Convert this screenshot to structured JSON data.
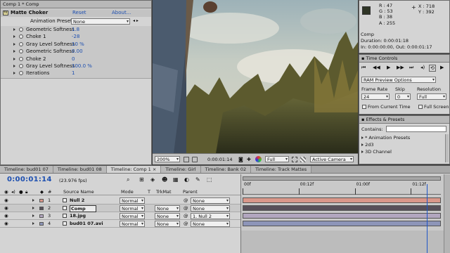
{
  "effect_panel": {
    "tab_title": "Comp 1 * Comp",
    "effect_name": "Matte Choker",
    "reset_label": "Reset",
    "about_label": "About...",
    "presets_label": "Animation Presets:",
    "presets_value": "None",
    "params": [
      {
        "name": "Geometric Softness",
        "value": "1.8"
      },
      {
        "name": "Choke 1",
        "value": "-28"
      },
      {
        "name": "Gray Level Softness",
        "value": "10 %"
      },
      {
        "name": "Geometric Softness",
        "value": "0.00"
      },
      {
        "name": "Choke 2",
        "value": "0"
      },
      {
        "name": "Gray Level Softness",
        "value": "100.0 %"
      },
      {
        "name": "Iterations",
        "value": "1"
      }
    ]
  },
  "viewer": {
    "zoom": "200%",
    "timecode": "0:00:01:14",
    "resolution": "Full",
    "camera": "Active Camera"
  },
  "info_panel": {
    "r_label": "R :",
    "r_value": "47",
    "g_label": "G :",
    "g_value": "53",
    "b_label": "B :",
    "b_value": "38",
    "a_label": "A :",
    "a_value": "255",
    "x_label": "X :",
    "x_value": "718",
    "y_label": "Y :",
    "y_value": "392",
    "swatch_color": "#2f3526",
    "comp_name": "Comp",
    "duration": "Duration: 0:00:01:18",
    "in_out": "In: 0:00:00:00, Out: 0:00:01:17"
  },
  "time_controls": {
    "title": "Time Controls",
    "preview_options": "RAM Preview Options",
    "frame_rate_label": "Frame Rate",
    "frame_rate_value": "24",
    "skip_label": "Skip",
    "skip_value": "0",
    "resolution_label": "Resolution",
    "resolution_value": "Full",
    "from_current_label": "From Current Time",
    "full_screen_label": "Full Screen"
  },
  "effects_presets": {
    "title": "Effects & Presets",
    "contains_label": "Contains:",
    "items": [
      "* Animation Presets",
      "2d3",
      "3D Channel"
    ]
  },
  "timeline": {
    "tabs": [
      "Timeline: bud01 07",
      "Timeline: bud01 08",
      "Timeline: Comp 1",
      "Timeline: Girl",
      "Timeline: Bank 02",
      "Timeline: Track Mattes"
    ],
    "active_tab": 2,
    "current_time": "0:00:01:14",
    "fps": "(23.976 fps)",
    "col_source": "Source Name",
    "col_mode": "Mode",
    "col_t": "T",
    "col_trkmat": "TrkMat",
    "col_parent": "Parent",
    "ruler": [
      "00f",
      "00:12f",
      "01:00f",
      "01:12f"
    ],
    "playhead_fraction": 0.93,
    "layers": [
      {
        "num": "1",
        "name": "Null 2",
        "mode": "Normal",
        "trkmat": "",
        "parent": "None",
        "color": "#d9978a"
      },
      {
        "num": "2",
        "name": "Comp",
        "mode": "Normal",
        "trkmat": "None",
        "parent": "None",
        "color": "#58505a"
      },
      {
        "num": "3",
        "name": "18.jpg",
        "mode": "Normal",
        "trkmat": "None",
        "parent": "1. Null 2",
        "color": "#b2a6bf"
      },
      {
        "num": "4",
        "name": "bud01 07.avi",
        "mode": "Normal",
        "trkmat": "None",
        "parent": "None",
        "color": "#8d95b8"
      }
    ]
  }
}
